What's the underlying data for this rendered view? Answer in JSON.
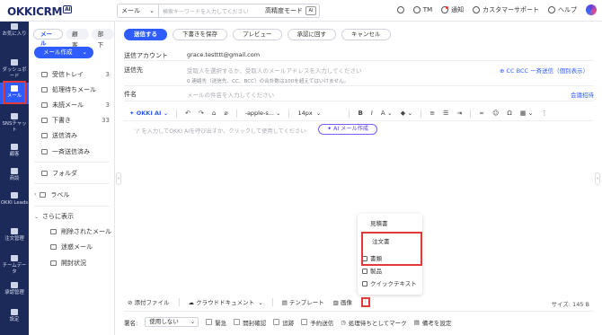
{
  "header": {
    "logo": "OKKICRM",
    "logo_ai": "AI",
    "search_scope": "メール",
    "search_placeholder": "検索キーワードを入力してください",
    "search_advanced": "高精度モード",
    "search_ai": "AI",
    "user": "TM",
    "notify": "通知",
    "support": "カスタマーサポート",
    "help": "ヘルプ"
  },
  "leftnav": [
    {
      "label": "お気に入り",
      "icon": "star-icon"
    },
    {
      "label": "ダッシュボード",
      "icon": "dashboard-icon"
    },
    {
      "label": "メール",
      "icon": "mail-icon",
      "active": true
    },
    {
      "label": "SNSチャット",
      "icon": "chat-icon"
    },
    {
      "label": "顧客",
      "icon": "customer-icon"
    },
    {
      "label": "商談",
      "icon": "deal-icon"
    },
    {
      "label": "OKKI Leads",
      "icon": "leads-icon"
    },
    {
      "label": "注文管理",
      "icon": "order-icon"
    },
    {
      "label": "チームデータ",
      "icon": "team-data-icon"
    },
    {
      "label": "承認管理",
      "icon": "approval-icon"
    },
    {
      "label": "設定",
      "icon": "settings-icon"
    }
  ],
  "mail_sidebar": {
    "tabs": [
      "メール",
      "顧客",
      "部下"
    ],
    "compose": "メール作成",
    "folders": [
      {
        "label": "受信トレイ",
        "count": "3"
      },
      {
        "label": "処理待ちメール",
        "count": ""
      },
      {
        "label": "未読メール",
        "count": "3"
      },
      {
        "label": "下書き",
        "count": "33"
      },
      {
        "label": "送信済み",
        "count": ""
      },
      {
        "label": "一斉送信済み",
        "count": ""
      }
    ],
    "folder_label": "フォルダ",
    "label_label": "ラベル",
    "more_label": "さらに表示",
    "more_items": [
      "削除されたメール",
      "迷惑メール",
      "開封状況"
    ]
  },
  "toolbar": {
    "send": "送信する",
    "save_draft": "下書きを保存",
    "preview": "プレビュー",
    "approval": "承認に回す",
    "cancel": "キャンセル"
  },
  "form": {
    "account_label": "送信アカウント",
    "account_value": "grace.testttt@gmail.com",
    "to_label": "送信先",
    "to_placeholder": "受取人を選択するか、受取人のメールアドレスを入力してください",
    "to_hint": "0 連絡先（送信先、CC、BCC）の合計数は100を超えてはいけません。",
    "cc_links": "CC  BCC  一斉送信（個別表示）",
    "subject_label": "件名",
    "subject_placeholder": "メールの件名を入力してください",
    "meeting_invite": "会議招待"
  },
  "editor": {
    "ai_label": "OKKI AI",
    "font": "-apple-s...",
    "size": "14px",
    "placeholder": "'/' を入力してOKKI AIを呼び出すか、クリックして使用してください",
    "ai_compose": "AI メール作成"
  },
  "bottombar": {
    "attach": "添付ファイル",
    "cloud": "クラウドドキュメント",
    "template": "テンプレート",
    "image": "画像",
    "more": "⋮",
    "size": "サイズ: 145 B"
  },
  "options": {
    "signature_label": "署名:",
    "signature_value": "使用しない",
    "urgent": "緊急",
    "read_receipt": "開封確認",
    "tracking": "追跡",
    "scheduled": "予約送信",
    "mark_pending": "処理待ちとしてマーク",
    "memo": "備考を設定"
  },
  "dropdown": {
    "items": [
      "見積書",
      "注文書",
      "書類",
      "製品",
      "クイックテキスト"
    ]
  },
  "colors": {
    "primary": "#2f5cff",
    "nav_bg": "#1b2a59",
    "highlight": "#e23a3a"
  }
}
